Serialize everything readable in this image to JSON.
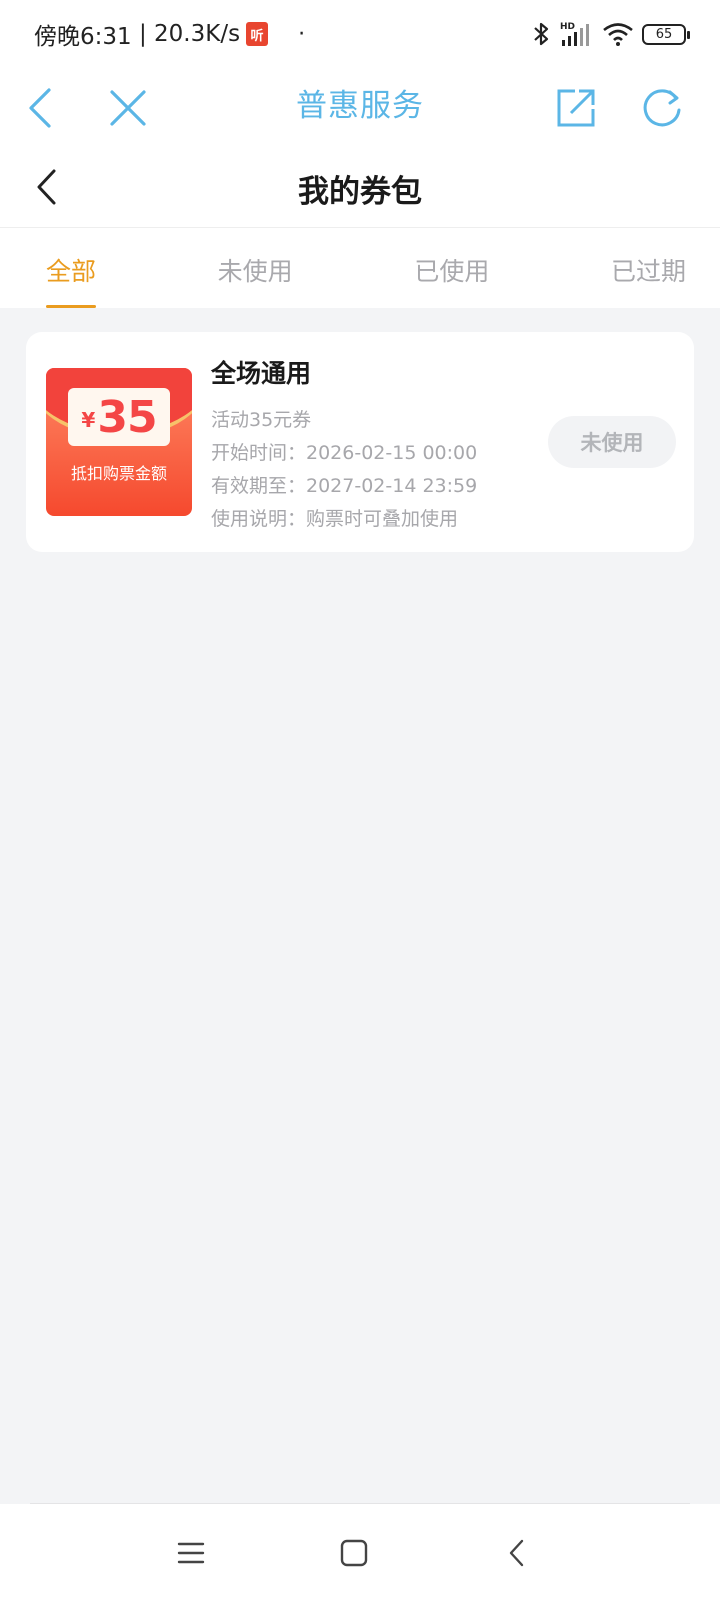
{
  "status_bar": {
    "time": "傍晚6:31",
    "net_speed": "20.3K/s",
    "app_badge": "听",
    "dot": "·",
    "hd": "HD",
    "battery": "65"
  },
  "toolbar": {
    "title": "普惠服务",
    "accent_color": "#5bb6e6"
  },
  "page": {
    "title": "我的券包"
  },
  "tabs": [
    {
      "label": "全部",
      "active": true
    },
    {
      "label": "未使用",
      "active": false
    },
    {
      "label": "已使用",
      "active": false
    },
    {
      "label": "已过期",
      "active": false
    }
  ],
  "coupon": {
    "image": {
      "currency": "¥",
      "amount": "35",
      "caption": "抵扣购票金额"
    },
    "name": "全场通用",
    "subtitle": "活动35元券",
    "start": "开始时间：2026-02-15 00:00",
    "expire": "有效期至：2027-02-14 23:59",
    "usage": "使用说明：购票时可叠加使用",
    "status": "未使用"
  },
  "colors": {
    "tab_active": "#ea9c1f",
    "background": "#f3f4f6"
  }
}
